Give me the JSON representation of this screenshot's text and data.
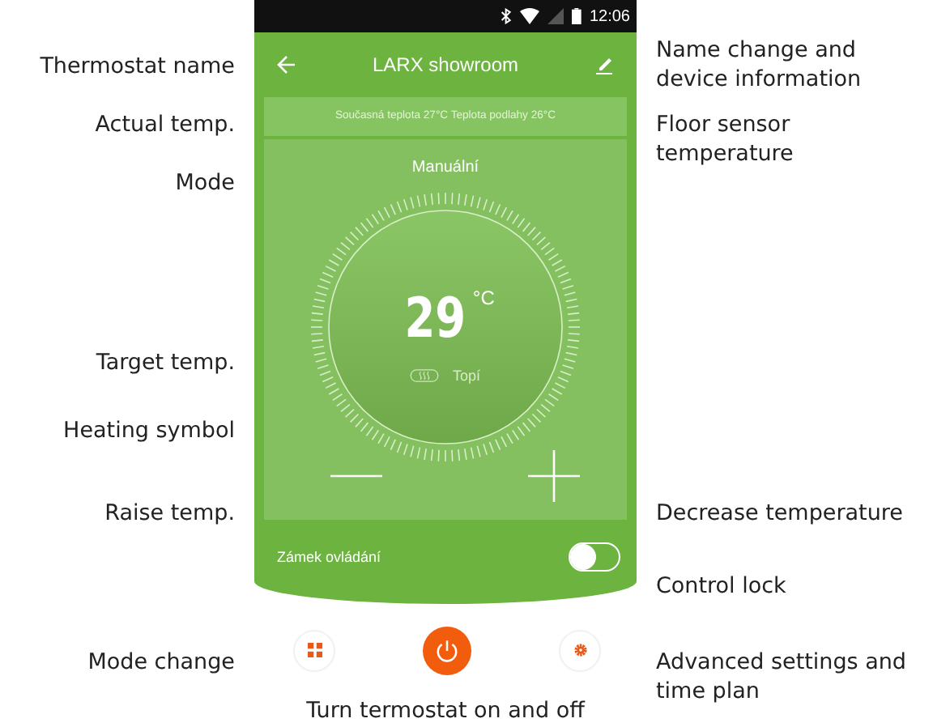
{
  "left_labels": [
    "Thermostat name",
    "Actual temp.",
    "Mode",
    "Target temp.",
    "Heating symbol",
    "Raise temp.",
    "Mode change"
  ],
  "right_labels": [
    "Name change and\ndevice information",
    "Floor sensor\ntemperature",
    "Decrease temperature",
    "Control lock",
    "Advanced settings and\ntime plan"
  ],
  "phone": {
    "status_bar": {
      "time": "12:06"
    },
    "header": {
      "title": "LARX showroom"
    },
    "info": "Současná teplota 27°C Teplota podlahy 26°C",
    "mode": "Manuální",
    "dial": {
      "temperature": "29",
      "unit": "°C",
      "heating_label": "Topí"
    },
    "lock": {
      "label": "Zámek ovládání",
      "on": false
    }
  },
  "caption": "Turn termostat on and off"
}
